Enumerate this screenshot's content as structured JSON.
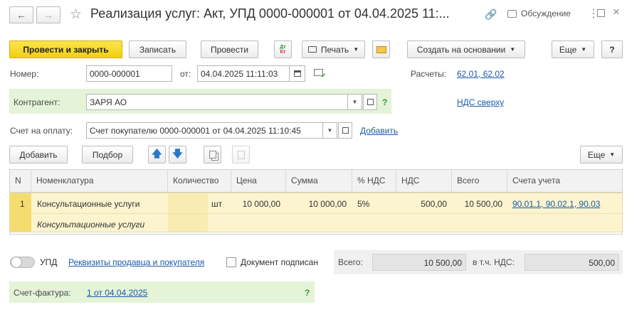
{
  "header": {
    "title": "Реализация услуг: Акт, УПД 0000-000001 от 04.04.2025 11:...",
    "discussion_label": "Обсуждение"
  },
  "toolbar": {
    "post_close": "Провести и закрыть",
    "save": "Записать",
    "post": "Провести",
    "print": "Печать",
    "create_based_on": "Создать на основании",
    "more": "Еще",
    "help": "?",
    "dtkt_top": "Дт",
    "dtkt_bottom": "Кт"
  },
  "form": {
    "number_label": "Номер:",
    "number_value": "0000-000001",
    "date_label": "от:",
    "date_value": "04.04.2025 11:11:03",
    "settlements_label": "Расчеты:",
    "settlements_link": "62.01, 62.02",
    "counterparty_label": "Контрагент:",
    "counterparty_value": "ЗАРЯ АО",
    "vat_on_top_link": "НДС сверху",
    "invoice_label": "Счет на оплату:",
    "invoice_value": "Счет покупателю 0000-000001 от 04.04.2025 11:10:45",
    "invoice_add_link": "Добавить",
    "help_q": "?"
  },
  "table_toolbar": {
    "add": "Добавить",
    "select": "Подбор",
    "more": "Еще"
  },
  "table": {
    "columns": [
      "N",
      "Номенклатура",
      "Количество",
      "Цена",
      "Сумма",
      "% НДС",
      "НДС",
      "Всего",
      "Счета учета"
    ],
    "rows": [
      {
        "n": "1",
        "nomenclature": "Консультационные услуги",
        "nomenclature_sub": "Консультационные услуги",
        "quantity": "",
        "unit": "шт",
        "price": "10 000,00",
        "sum": "10 000,00",
        "vat_rate": "5%",
        "vat": "500,00",
        "total": "10 500,00",
        "accounts": "90.01.1, 90.02.1, 90.03"
      }
    ]
  },
  "footer": {
    "upd_label": "УПД",
    "requisites_link": "Реквизиты продавца и покупателя",
    "signed_label": "Документ подписан",
    "total_label": "Всего:",
    "total_value": "10 500,00",
    "vat_label": "в т.ч. НДС:",
    "vat_value": "500,00",
    "invoice_label": "Счет-фактура:",
    "invoice_link": "1 от 04.04.2025",
    "help_q": "?"
  },
  "colors": {
    "primary_button": "#f2cf13",
    "link": "#1a5aa5",
    "green_panel": "#e5f3d8",
    "row_highlight": "#fbf4cf"
  }
}
